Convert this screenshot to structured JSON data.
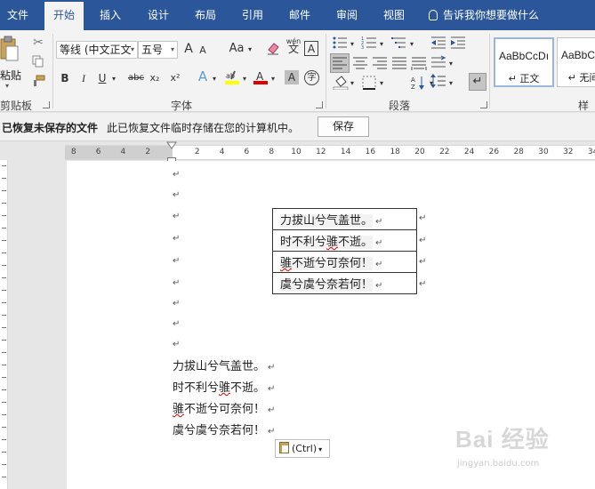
{
  "tabs": [
    {
      "label": "文件"
    },
    {
      "label": "开始"
    },
    {
      "label": "插入"
    },
    {
      "label": "设计"
    },
    {
      "label": "布局"
    },
    {
      "label": "引用"
    },
    {
      "label": "邮件"
    },
    {
      "label": "审阅"
    },
    {
      "label": "视图"
    }
  ],
  "active_tab": "开始",
  "tell_me": "告诉我你想要做什么",
  "ribbon": {
    "clipboard": {
      "paste_label": "粘贴",
      "group_label": "剪贴板"
    },
    "font": {
      "font_name": "等线 (中文正文",
      "font_size": "五号",
      "group_label": "字体",
      "grow_label": "A",
      "shrink_label": "A",
      "case_label": "Aa",
      "bold": "B",
      "italic": "I",
      "underline": "U",
      "strike": "abc",
      "subscript": "x₂",
      "superscript": "x²",
      "wen_label": "wén",
      "border_label": "A",
      "font_color_label": "A",
      "shading_label": "A",
      "enclose_label": "字"
    },
    "paragraph": {
      "group_label": "段落"
    },
    "styles": {
      "items": [
        {
          "sample": "AaBbCcDı",
          "name": "↵ 正文"
        },
        {
          "sample": "AaBbC",
          "name": "↵ 无间"
        }
      ],
      "group_label": "样式"
    }
  },
  "message_bar": {
    "title": "已恢复未保存的文件",
    "text": "此已恢复文件临时存储在您的计算机中。",
    "button": "保存"
  },
  "ruler": {
    "left_numbers": [
      "8",
      "6",
      "4",
      "2"
    ],
    "right_numbers": [
      "2",
      "4",
      "6",
      "8",
      "10",
      "12",
      "14",
      "16",
      "18",
      "20",
      "22",
      "24",
      "26",
      "28",
      "30",
      "32",
      "34"
    ]
  },
  "document": {
    "empty_paragraph_mark": "↵",
    "table_rows": [
      {
        "text": "力拔山兮气盖世。",
        "mark": "↵"
      },
      {
        "text": "时不利兮骓不逝。",
        "mark": "↵"
      },
      {
        "text": "骓不逝兮可奈何！",
        "mark": "↵"
      },
      {
        "text": "虞兮虞兮奈若何！",
        "mark": "↵"
      }
    ],
    "lines": [
      {
        "pre": "力拔山兮气盖世。",
        "word": "",
        "post": ""
      },
      {
        "pre": "时不利兮",
        "word": "骓",
        "post": "不逝。"
      },
      {
        "pre": "",
        "word": "骓",
        "post": "不逝兮可奈何！"
      },
      {
        "pre": "虞兮虞兮奈若何！",
        "word": "",
        "post": ""
      }
    ],
    "paste_options": "(Ctrl)"
  },
  "watermark": {
    "text": "Bai 经验",
    "url": "jingyan.baidu.com"
  }
}
